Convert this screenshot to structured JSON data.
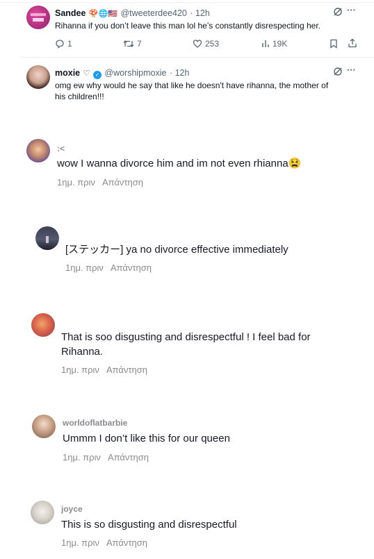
{
  "tweets": [
    {
      "name": "Sandee",
      "name_emojis": "🍄🌐🇺🇸",
      "handle": "@tweeterdee420",
      "time": "· 12h",
      "text": "Rihanna if you don’t leave this man lol he’s constantly disrespecting her.",
      "replies": "1",
      "retweets": "7",
      "likes": "253",
      "views": "19K"
    },
    {
      "name": "moxie",
      "name_emojis": "♡",
      "handle": "@worshipmoxie",
      "time": "· 12h",
      "text_line1": "omg ew why would he say that like he doesn't have rihanna, the mother of",
      "text_line2": "his children!!!"
    }
  ],
  "comments": [
    {
      "username": ":<",
      "text": "wow I wanna divorce him and im not even rhianna😫",
      "time": "1ημ. πριν",
      "reply": "Απάντηση"
    },
    {
      "username": "",
      "text": "[ステッカー] ya no divorce effective immediately",
      "time": "1ημ. πριν",
      "reply": "Απάντηση"
    },
    {
      "username": "",
      "text_line1": "That is soo disgusting and disrespectful ! I feel bad for",
      "text_line2": "Rihanna.",
      "time": "1ημ. πριν",
      "reply": "Απάντηση"
    },
    {
      "username": "worldoflatbarbie",
      "text": "Ummm I don’t like this for our queen",
      "time": "1ημ. πριν",
      "reply": "Απάντηση"
    },
    {
      "username": "joyce",
      "text": "This is so disgusting and disrespectful",
      "time": "1ημ. πριν",
      "reply": "Απάντηση"
    }
  ],
  "icons": {
    "reply": "reply-icon",
    "retweet": "retweet-icon",
    "like": "heart-icon",
    "views": "views-icon",
    "bookmark": "bookmark-icon",
    "share": "share-icon",
    "grok": "grok-icon",
    "more": "more-icon"
  },
  "colors": {
    "verified_blue": "#1d9bf0",
    "secondary_text": "#536471",
    "comment_meta": "#8a8b91"
  }
}
